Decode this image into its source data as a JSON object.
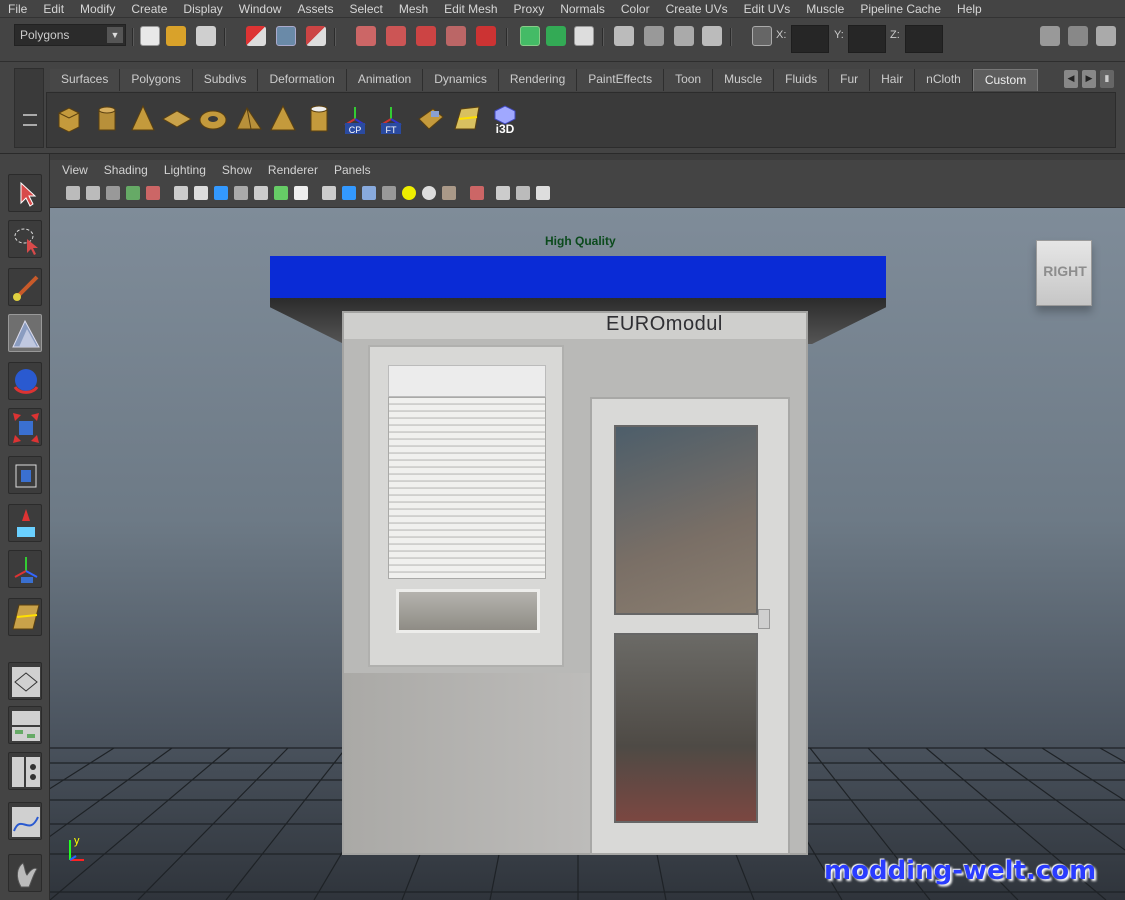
{
  "menu_bar": {
    "items": [
      "File",
      "Edit",
      "Modify",
      "Create",
      "Display",
      "Window",
      "Assets",
      "Select",
      "Mesh",
      "Edit Mesh",
      "Proxy",
      "Normals",
      "Color",
      "Create UVs",
      "Edit UVs",
      "Muscle",
      "Pipeline Cache",
      "Help"
    ]
  },
  "status_line": {
    "mode_menu": "Polygons",
    "x_label": "X:",
    "y_label": "Y:",
    "z_label": "Z:"
  },
  "shelf": {
    "tabs": [
      "Surfaces",
      "Polygons",
      "Subdivs",
      "Deformation",
      "Animation",
      "Dynamics",
      "Rendering",
      "PaintEffects",
      "Toon",
      "Muscle",
      "Fluids",
      "Fur",
      "Hair",
      "nCloth",
      "Custom"
    ],
    "active_tab": "Custom",
    "icon_labels": {
      "cp": "CP",
      "ft": "FT",
      "i3d": "i3D"
    }
  },
  "panel_menu": {
    "items": [
      "View",
      "Shading",
      "Lighting",
      "Show",
      "Renderer",
      "Panels"
    ]
  },
  "viewport": {
    "hq_label": "High Quality",
    "view_cube_face": "RIGHT",
    "brand_text": "EUROmodul",
    "axis_label": "y",
    "watermark": "modding-welt.com"
  },
  "colors": {
    "roof_blue": "#0a2bd6",
    "watermark_blue": "#2a3cff",
    "hq_green": "#0b4a1c"
  }
}
